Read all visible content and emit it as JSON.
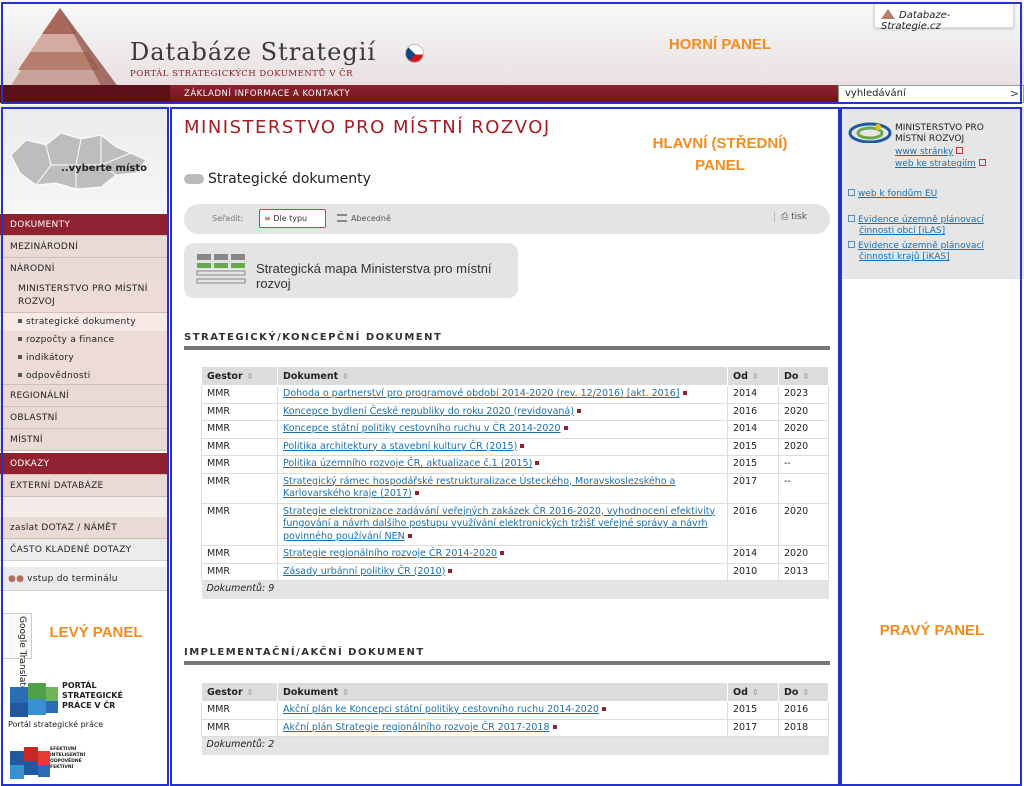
{
  "header": {
    "title": "Databáze Strategií",
    "subtitle": "PORTÁL STRATEGICKÝCH DOKUMENTŮ V ČR",
    "site_link": "Databaze-Strategie.cz",
    "nav_item": "ZÁKLADNÍ INFORMACE A KONTAKTY",
    "search_value": "vyhledávání",
    "search_go": ">"
  },
  "labels": {
    "top": "HORNÍ PANEL",
    "main_line1": "HLAVNÍ (STŘEDNÍ)",
    "main_line2": "PANEL",
    "left": "LEVÝ PANEL",
    "right": "PRAVÝ PANEL"
  },
  "left": {
    "map_label": "..vyberte místo",
    "menu": {
      "dokumenty": "DOKUMENTY",
      "mezinarodni": "MEZINÁRODNÍ",
      "narodni": "NÁRODNÍ",
      "mmr": "MINISTERSTVO PRO MÍSTNÍ ROZVOJ",
      "strategicke": "strategické dokumenty",
      "rozpocty": "rozpočty a finance",
      "indikatory": "indikátory",
      "odpovednosti": "odpovědnosti",
      "regionalni": "REGIONÁLNÍ",
      "oblastni": "OBLASTNÍ",
      "mistni": "MÍSTNÍ",
      "odkazy": "ODKAZY",
      "externi": "EXTERNÍ DATABÁZE",
      "dotaz": "zaslat DOTAZ / NÁMĚT",
      "faq": "ČASTO KLADENÉ DOTAZY",
      "terminal": "vstup do terminálu"
    },
    "google_translate": "Google Translate",
    "portal_name_lines": [
      "PORTÁL",
      "STRATEGICKÉ",
      "PRÁCE V ČR"
    ],
    "portal_caption": "Portál strategické práce",
    "cube2_lines": [
      "EFEKTIVNÍ",
      "INTELIGENTNÍ",
      "ODPOVĚDNÉ",
      "FEKTIVNÍ"
    ]
  },
  "main": {
    "title": "MINISTERSTVO PRO MÍSTNÍ ROZVOJ",
    "section": "Strategické dokumenty",
    "sort_label": "Seřadit:",
    "sort_by_type": "Dle typu",
    "sort_alpha": "Abecedně",
    "print": "tisk",
    "map_button": "Strategická mapa Ministerstva pro místní rozvoj",
    "columns": {
      "gestor": "Gestor",
      "dokument": "Dokument",
      "od": "Od",
      "do": "Do"
    },
    "strategic": {
      "heading": "STRATEGICKÝ/KONCEPČNÍ DOKUMENT",
      "count": "Dokumentů: 9",
      "rows": [
        {
          "gestor": "MMR",
          "doc": "Dohoda o partnerství pro programové období 2014-2020 (rev. 12/2016) [akt. 2016]",
          "od": "2014",
          "do": "2023"
        },
        {
          "gestor": "MMR",
          "doc": "Koncepce bydlení České republiky do roku 2020 (revidovaná)",
          "od": "2016",
          "do": "2020"
        },
        {
          "gestor": "MMR",
          "doc": "Koncepce státní politiky cestovního ruchu v ČR 2014-2020",
          "od": "2014",
          "do": "2020"
        },
        {
          "gestor": "MMR",
          "doc": "Politika architektury a stavební kultury ČR (2015)",
          "od": "2015",
          "do": "2020"
        },
        {
          "gestor": "MMR",
          "doc": "Politika územního rozvoje ČR, aktualizace č.1 (2015)",
          "od": "2015",
          "do": "--"
        },
        {
          "gestor": "MMR",
          "doc": "Strategický rámec hospodářské restrukturalizace Ústeckého, Moravskoslezského a Karlovarského kraje (2017)",
          "od": "2017",
          "do": "--"
        },
        {
          "gestor": "MMR",
          "doc": "Strategie elektronizace zadávání veřejných zakázek ČR 2016-2020, vyhodnocení efektivity fungování a návrh dalšího postupu využívání elektronických tržišť veřejné správy a návrh povinného používání NEN",
          "od": "2016",
          "do": "2020"
        },
        {
          "gestor": "MMR",
          "doc": "Strategie regionálního rozvoje ČR 2014-2020",
          "od": "2014",
          "do": "2020"
        },
        {
          "gestor": "MMR",
          "doc": "Zásady urbánní politiky ČR (2010)",
          "od": "2010",
          "do": "2013"
        }
      ]
    },
    "implementation": {
      "heading": "IMPLEMENTAČNÍ/AKČNÍ DOKUMENT",
      "count": "Dokumentů: 2",
      "rows": [
        {
          "gestor": "MMR",
          "doc": "Akční plán ke Koncepci státní politiky cestovního ruchu 2014-2020",
          "od": "2015",
          "do": "2016"
        },
        {
          "gestor": "MMR",
          "doc": "Akční plán Strategie regionálního rozvoje ČR 2017-2018",
          "od": "2017",
          "do": "2018"
        }
      ]
    }
  },
  "right": {
    "org_line1": "MINISTERSTVO PRO",
    "org_line2": "MÍSTNÍ ROZVOJ",
    "www": "www stránky",
    "strategy_web": "web ke strategiím",
    "eu_funds": "web k fondům EU",
    "ilas_line1": "Evidence územně plánovací",
    "ilas_line2": "činnosti obcí [iLAS]",
    "ikas_line1": "Evidence územně plánovací",
    "ikas_line2": "činnosti krajů [iKAS]"
  }
}
